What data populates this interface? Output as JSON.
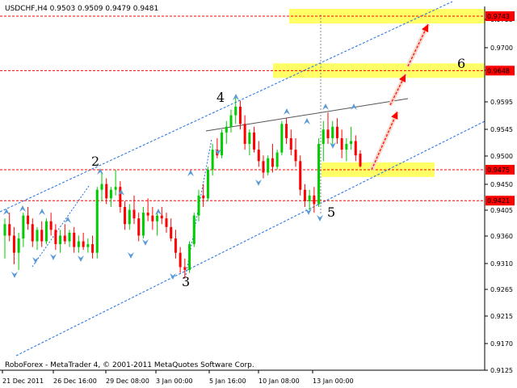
{
  "chart_data": {
    "type": "candlestick",
    "title": "USDCHF,H4  0.9503 0.9509 0.9479 0.9481",
    "footer": "RoboForex - MetaTrader 4, © 2001-2011 MetaQuotes Software Corp.",
    "ylim": [
      0.9125,
      0.9743
    ],
    "y_ticks": [
      "0.9755",
      "0.9700",
      "0.9650",
      "0.9595",
      "0.9545",
      "0.9500",
      "0.9450",
      "0.9405",
      "0.9360",
      "0.9310",
      "0.9265",
      "0.9215",
      "0.9170",
      "0.9125"
    ],
    "x_ticks": [
      "21 Dec 2011",
      "26 Dec 16:00",
      "29 Dec 08:00",
      "3 Jan 00:00",
      "5 Jan 16:00",
      "10 Jan 08:00",
      "13 Jan 00:00"
    ],
    "levels": [
      {
        "value": 0.9743,
        "label": "0.9743",
        "zone": true
      },
      {
        "value": 0.9648,
        "label": "0.9648",
        "zone": true
      },
      {
        "value": 0.9475,
        "label": "0.9475",
        "zone": true
      },
      {
        "value": 0.9421,
        "label": "0.9421",
        "zone": false
      }
    ],
    "wave_labels": [
      "2",
      "3",
      "4",
      "5",
      "6"
    ],
    "grid": false,
    "colors": {
      "up": "#00cc00",
      "down": "#ff0000",
      "level": "#ff0000",
      "channel": "#1e6fe0",
      "zone": "#ffff66",
      "arrow": "#ff0000",
      "fractal": "#5b9bd5"
    },
    "candles": [
      [
        0.936,
        0.939,
        0.932,
        0.938
      ],
      [
        0.938,
        0.94,
        0.935,
        0.936
      ],
      [
        0.936,
        0.9375,
        0.931,
        0.933
      ],
      [
        0.933,
        0.9365,
        0.93,
        0.9355
      ],
      [
        0.9355,
        0.94,
        0.934,
        0.9395
      ],
      [
        0.9395,
        0.941,
        0.937,
        0.938
      ],
      [
        0.938,
        0.939,
        0.934,
        0.935
      ],
      [
        0.935,
        0.9375,
        0.9335,
        0.937
      ],
      [
        0.937,
        0.9385,
        0.934,
        0.935
      ],
      [
        0.935,
        0.939,
        0.9345,
        0.9385
      ],
      [
        0.9385,
        0.94,
        0.936,
        0.937
      ],
      [
        0.937,
        0.938,
        0.9335,
        0.9345
      ],
      [
        0.9345,
        0.937,
        0.933,
        0.936
      ],
      [
        0.936,
        0.938,
        0.9345,
        0.935
      ],
      [
        0.935,
        0.937,
        0.934,
        0.9365
      ],
      [
        0.9365,
        0.9375,
        0.933,
        0.934
      ],
      [
        0.934,
        0.936,
        0.933,
        0.935
      ],
      [
        0.935,
        0.9365,
        0.9335,
        0.934
      ],
      [
        0.934,
        0.9355,
        0.933,
        0.9345
      ],
      [
        0.9345,
        0.936,
        0.932,
        0.933
      ],
      [
        0.933,
        0.9445,
        0.932,
        0.944
      ],
      [
        0.944,
        0.947,
        0.942,
        0.945
      ],
      [
        0.945,
        0.946,
        0.9415,
        0.9425
      ],
      [
        0.9425,
        0.9445,
        0.941,
        0.944
      ],
      [
        0.944,
        0.9475,
        0.943,
        0.9445
      ],
      [
        0.9445,
        0.9455,
        0.94,
        0.941
      ],
      [
        0.941,
        0.942,
        0.937,
        0.938
      ],
      [
        0.938,
        0.9415,
        0.937,
        0.9405
      ],
      [
        0.9405,
        0.943,
        0.938,
        0.939
      ],
      [
        0.939,
        0.94,
        0.935,
        0.936
      ],
      [
        0.936,
        0.941,
        0.9355,
        0.94
      ],
      [
        0.94,
        0.9425,
        0.9385,
        0.9395
      ],
      [
        0.9395,
        0.941,
        0.937,
        0.9385
      ],
      [
        0.9385,
        0.94,
        0.936,
        0.9395
      ],
      [
        0.9395,
        0.941,
        0.938,
        0.939
      ],
      [
        0.939,
        0.94,
        0.9365,
        0.9375
      ],
      [
        0.9375,
        0.939,
        0.935,
        0.9355
      ],
      [
        0.9355,
        0.937,
        0.932,
        0.933
      ],
      [
        0.933,
        0.934,
        0.9295,
        0.9305
      ],
      [
        0.9305,
        0.932,
        0.9285,
        0.93
      ],
      [
        0.93,
        0.935,
        0.9295,
        0.9345
      ],
      [
        0.9345,
        0.94,
        0.934,
        0.9395
      ],
      [
        0.9395,
        0.944,
        0.9385,
        0.943
      ],
      [
        0.943,
        0.945,
        0.941,
        0.9425
      ],
      [
        0.9425,
        0.948,
        0.942,
        0.9475
      ],
      [
        0.9475,
        0.952,
        0.9465,
        0.951
      ],
      [
        0.951,
        0.953,
        0.9495,
        0.95
      ],
      [
        0.95,
        0.9545,
        0.9495,
        0.954
      ],
      [
        0.954,
        0.956,
        0.952,
        0.955
      ],
      [
        0.955,
        0.958,
        0.954,
        0.957
      ],
      [
        0.957,
        0.96,
        0.9555,
        0.9585
      ],
      [
        0.9585,
        0.9595,
        0.9545,
        0.9555
      ],
      [
        0.9555,
        0.957,
        0.951,
        0.952
      ],
      [
        0.952,
        0.9545,
        0.95,
        0.954
      ],
      [
        0.954,
        0.955,
        0.9505,
        0.951
      ],
      [
        0.951,
        0.9525,
        0.948,
        0.949
      ],
      [
        0.949,
        0.95,
        0.946,
        0.947
      ],
      [
        0.947,
        0.95,
        0.9465,
        0.9495
      ],
      [
        0.9495,
        0.952,
        0.947,
        0.948
      ],
      [
        0.948,
        0.951,
        0.9475,
        0.9505
      ],
      [
        0.9505,
        0.956,
        0.95,
        0.9555
      ],
      [
        0.9555,
        0.9565,
        0.952,
        0.953
      ],
      [
        0.953,
        0.9545,
        0.95,
        0.951
      ],
      [
        0.951,
        0.953,
        0.948,
        0.949
      ],
      [
        0.949,
        0.95,
        0.943,
        0.944
      ],
      [
        0.944,
        0.945,
        0.941,
        0.942
      ],
      [
        0.942,
        0.944,
        0.9405,
        0.943
      ],
      [
        0.943,
        0.9445,
        0.94,
        0.9415
      ],
      [
        0.9415,
        0.953,
        0.941,
        0.952
      ],
      [
        0.952,
        0.956,
        0.949,
        0.9545
      ],
      [
        0.9545,
        0.9575,
        0.952,
        0.953
      ],
      [
        0.953,
        0.956,
        0.9515,
        0.955
      ],
      [
        0.955,
        0.9565,
        0.952,
        0.953
      ],
      [
        0.953,
        0.9545,
        0.9495,
        0.951
      ],
      [
        0.951,
        0.953,
        0.949,
        0.952
      ],
      [
        0.952,
        0.955,
        0.951,
        0.9525
      ],
      [
        0.9525,
        0.9535,
        0.949,
        0.95
      ],
      [
        0.9503,
        0.9509,
        0.9479,
        0.9481
      ]
    ]
  }
}
